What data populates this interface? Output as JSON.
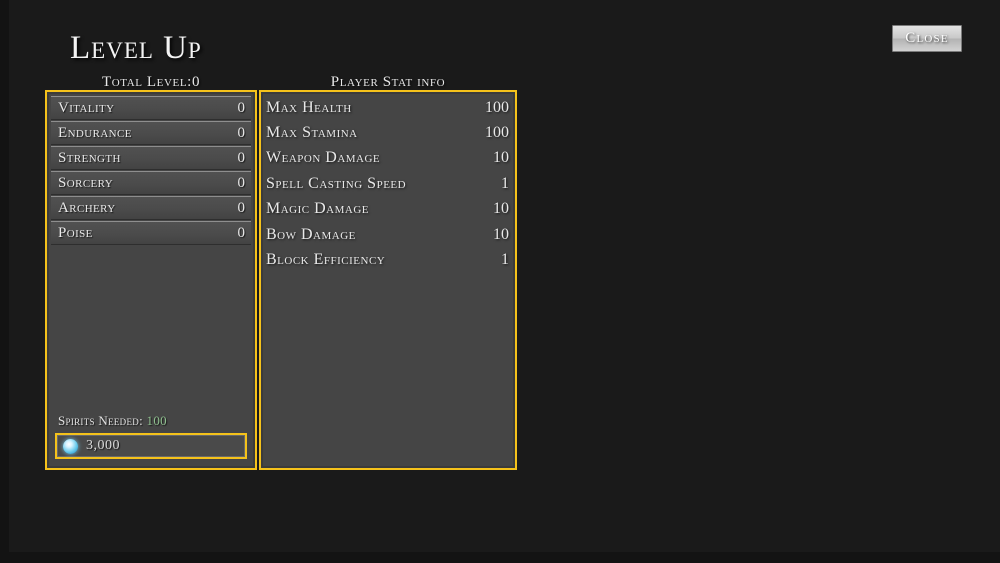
{
  "window": {
    "title": "Level Up",
    "background_color": "#1a1a1a",
    "accent_color": "#f5c21b"
  },
  "close_button": {
    "label": "Close"
  },
  "left_panel": {
    "header": "Total Level:0",
    "stats": [
      {
        "label": "Vitality",
        "value": "0"
      },
      {
        "label": "Endurance",
        "value": "0"
      },
      {
        "label": "Strength",
        "value": "0"
      },
      {
        "label": "Sorcery",
        "value": "0"
      },
      {
        "label": "Archery",
        "value": "0"
      },
      {
        "label": "Poise",
        "value": "0"
      }
    ],
    "spirits_needed_label": "Spirits Needed:",
    "spirits_needed_value": "100",
    "spirits_needed_color": "#8fbf8f",
    "currency": {
      "icon": "spirit-orb-icon",
      "amount": "3,000"
    }
  },
  "right_panel": {
    "header": "Player Stat info",
    "stats": [
      {
        "label": "Max Health",
        "value": "100"
      },
      {
        "label": "Max Stamina",
        "value": "100"
      },
      {
        "label": "Weapon Damage",
        "value": "10"
      },
      {
        "label": "Spell Casting Speed",
        "value": "1"
      },
      {
        "label": "Magic Damage",
        "value": "10"
      },
      {
        "label": "Bow Damage",
        "value": "10"
      },
      {
        "label": "Block Efficiency",
        "value": "1"
      }
    ]
  }
}
